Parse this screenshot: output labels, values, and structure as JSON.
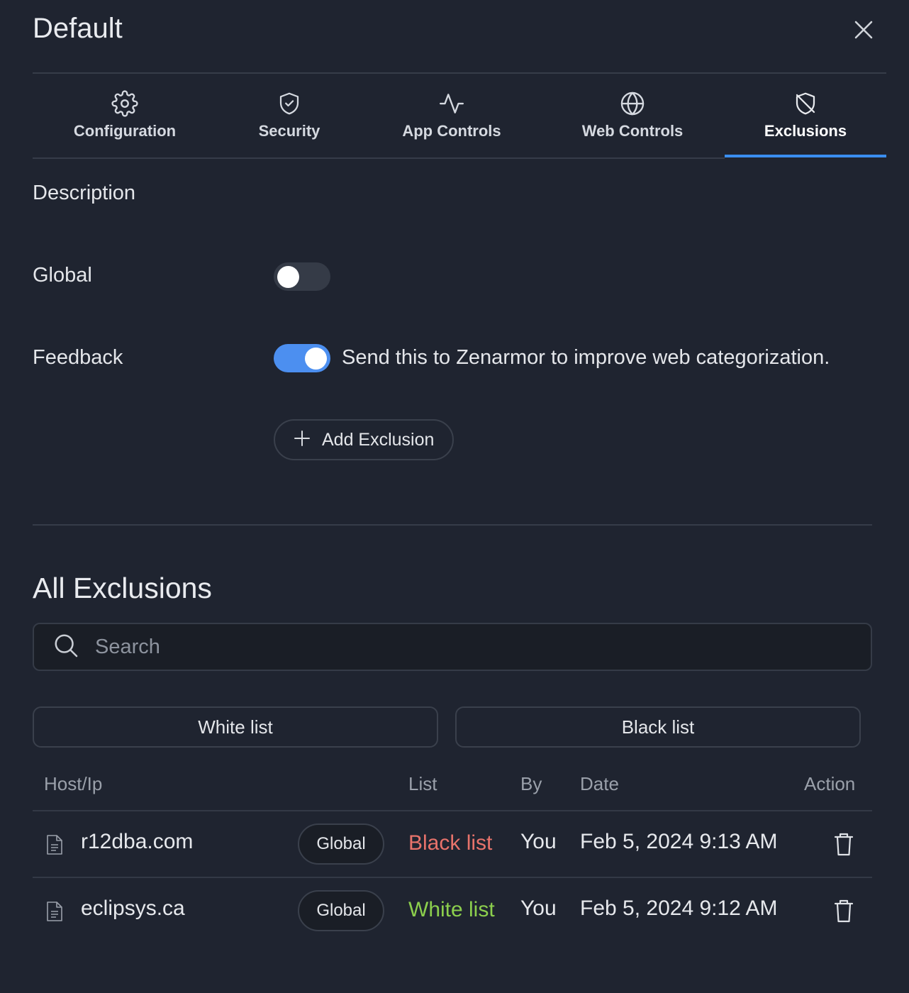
{
  "header": {
    "title": "Default"
  },
  "tabs": [
    {
      "label": "Configuration",
      "icon": "gear-icon"
    },
    {
      "label": "Security",
      "icon": "shield-check-icon"
    },
    {
      "label": "App Controls",
      "icon": "activity-icon"
    },
    {
      "label": "Web Controls",
      "icon": "globe-icon"
    },
    {
      "label": "Exclusions",
      "icon": "shield-off-icon",
      "active": true
    }
  ],
  "form": {
    "description_label": "Description",
    "global_label": "Global",
    "global_enabled": false,
    "feedback_label": "Feedback",
    "feedback_enabled": true,
    "feedback_text": "Send this to Zenarmor to improve web categorization.",
    "add_exclusion_label": "Add Exclusion"
  },
  "exclusions": {
    "title": "All Exclusions",
    "search_placeholder": "Search",
    "filters": {
      "white_list": "White list",
      "black_list": "Black list"
    },
    "columns": {
      "host": "Host/Ip",
      "list": "List",
      "by": "By",
      "date": "Date",
      "action": "Action"
    },
    "rows": [
      {
        "host": "r12dba.com",
        "scope": "Global",
        "list": "Black list",
        "list_color": "#e8736b",
        "by": "You",
        "date": "Feb 5, 2024 9:13 AM"
      },
      {
        "host": "eclipsys.ca",
        "scope": "Global",
        "list": "White list",
        "list_color": "#8ccf4d",
        "by": "You",
        "date": "Feb 5, 2024 9:12 AM"
      }
    ]
  },
  "colors": {
    "accent": "#3b8ef0",
    "background": "#1f2430",
    "toggle_on": "#4c8ff0",
    "toggle_off": "#353b47"
  }
}
